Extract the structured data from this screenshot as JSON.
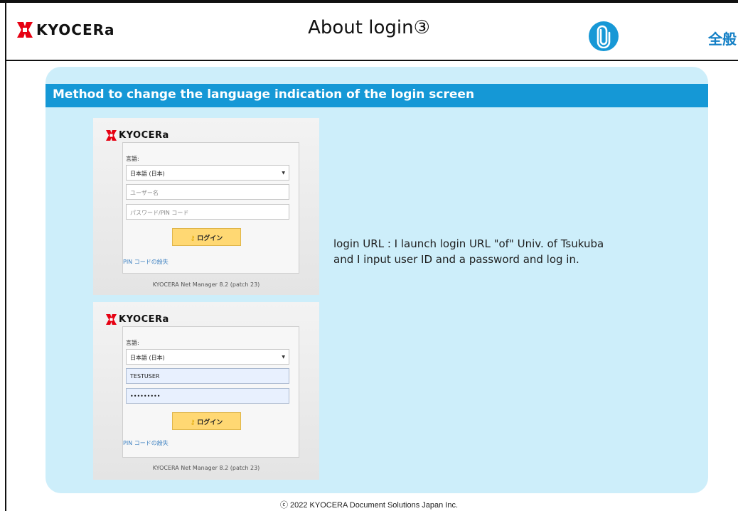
{
  "header": {
    "logo_text": "KYOCERa",
    "title": "About login③",
    "category": "全般",
    "brand_red": "#e60012",
    "accent_blue": "#1598d6"
  },
  "section": {
    "heading": "Method to change the language indication of the login screen",
    "description_line1": "login URL : I launch login URL \"of\" Univ. of Tsukuba",
    "description_line2": "and I input user ID and a password and log in."
  },
  "login_screens": [
    {
      "logo_text": "KYOCERa",
      "language_label": "言語:",
      "language_value": "日本語 (日本)",
      "username_placeholder": "ユーザー名",
      "password_placeholder": "パスワード/PIN コード",
      "login_button": "ログイン",
      "pin_link": "PIN コードの紛失",
      "version": "KYOCERA Net Manager 8.2 (patch 23)"
    },
    {
      "logo_text": "KYOCERa",
      "language_label": "言語:",
      "language_value": "日本語 (日本)",
      "username_value": "TESTUSER",
      "password_value": "•••••••••",
      "login_button": "ログイン",
      "pin_link": "PIN コードの紛失",
      "version": "KYOCERA Net Manager 8.2 (patch 23)"
    }
  ],
  "footer": {
    "copyright": "ⓒ 2022 KYOCERA Document Solutions Japan Inc."
  }
}
